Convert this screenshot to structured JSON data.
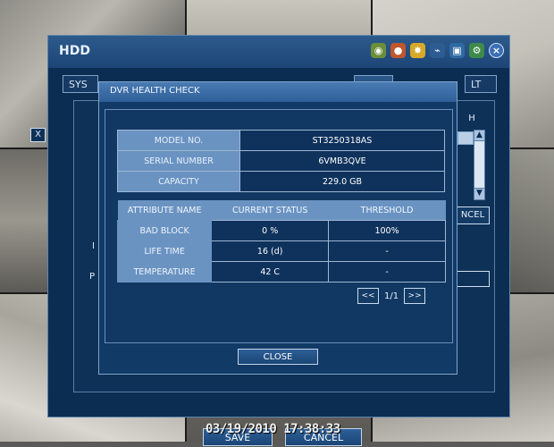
{
  "window": {
    "title": "HDD"
  },
  "tabs": [
    {
      "label": "SYS"
    },
    {
      "label": "LT"
    }
  ],
  "behind": {
    "x_label": "X",
    "cancel_partial": "NCEL",
    "h_partial": "H",
    "side_i": "I",
    "side_p": "P"
  },
  "dialog": {
    "title": "DVR HEALTH CHECK",
    "info": [
      {
        "label": "MODEL NO.",
        "value": "ST3250318AS"
      },
      {
        "label": "SERIAL NUMBER",
        "value": "6VMB3QVE"
      },
      {
        "label": "CAPACITY",
        "value": "229.0 GB"
      }
    ],
    "attr_headers": {
      "name": "ATTRIBUTE NAME",
      "status": "CURRENT STATUS",
      "threshold": "THRESHOLD"
    },
    "attributes": [
      {
        "name": "BAD BLOCK",
        "status": "0 %",
        "threshold": "100%"
      },
      {
        "name": "LIFE TIME",
        "status": "16 (d)",
        "threshold": "-"
      },
      {
        "name": "TEMPERATURE",
        "status": "42 C",
        "threshold": "-"
      }
    ],
    "pager": {
      "prev": "<<",
      "page": "1/1",
      "next": ">>"
    },
    "close_label": "CLOSE"
  },
  "footer": {
    "save_label": "SAVE",
    "cancel_label": "CANCEL"
  },
  "timestamp": "03/19/2010 17:38:33",
  "colors": {
    "window_bg": "#0c2d52",
    "label_cell": "#6a93c2",
    "value_cell": "#0e325c",
    "title_bar": "#2d5a8c"
  }
}
